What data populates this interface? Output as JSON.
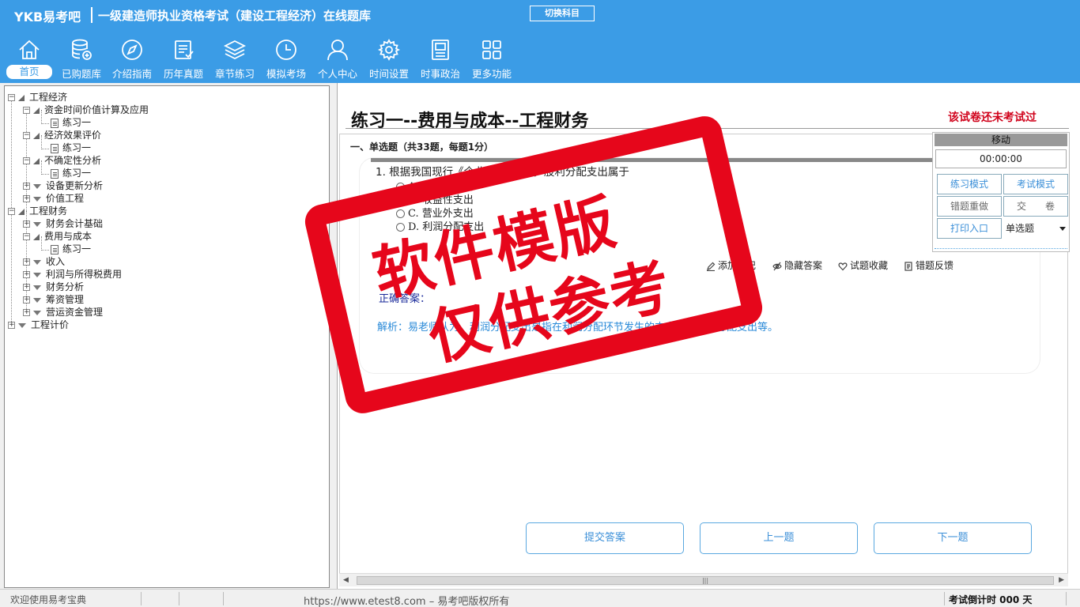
{
  "header": {
    "logo": "YKB易考吧",
    "title": "一级建造师执业资格考试（建设工程经济）在线题库",
    "switch_label": "切换科目"
  },
  "nav": [
    {
      "label": "首页",
      "icon": "home-icon"
    },
    {
      "label": "已购题库",
      "icon": "database-icon"
    },
    {
      "label": "介绍指南",
      "icon": "compass-icon"
    },
    {
      "label": "历年真题",
      "icon": "document-list-icon"
    },
    {
      "label": "章节练习",
      "icon": "layers-icon"
    },
    {
      "label": "模拟考场",
      "icon": "clock-icon"
    },
    {
      "label": "个人中心",
      "icon": "user-icon"
    },
    {
      "label": "时间设置",
      "icon": "gear-icon"
    },
    {
      "label": "时事政治",
      "icon": "news-icon"
    },
    {
      "label": "更多功能",
      "icon": "grid-icon"
    }
  ],
  "tree": {
    "expand_open": "−",
    "expand_closed": "+",
    "items": [
      "工程经济",
      "资金时间价值计算及应用",
      "练习一",
      "经济效果评价",
      "练习一",
      "不确定性分析",
      "练习一",
      "设备更新分析",
      "价值工程",
      "工程财务",
      "财务会计基础",
      "费用与成本",
      "练习一",
      "收入",
      "利润与所得税费用",
      "财务分析",
      "筹资管理",
      "营运资金管理",
      "工程计价"
    ]
  },
  "exam": {
    "title": "练习一--费用与成本--工程财务",
    "status": "该试卷还未考试过",
    "section": "一、单选题（共33题，每题1分）",
    "question": "1. 根据我国现行《企业会计准则》，股利分配支出属于",
    "options": [
      "A. 资本性支出",
      "B. 收益性支出",
      "C. 营业外支出",
      "D. 利润分配支出"
    ],
    "tools": [
      "添加笔记",
      "隐藏答案",
      "试题收藏",
      "错题反馈"
    ],
    "answer_label": "正确答案：",
    "analysis": "解析：易老师认为，利润分配支出是指在利润分配环节发生的支出，如股利分配支出等。"
  },
  "buttons": {
    "submit": "提交答案",
    "prev": "上一题",
    "next": "下一题"
  },
  "panel": {
    "move": "移动",
    "timer": "00:00:00",
    "practice_mode": "练习模式",
    "exam_mode": "考试模式",
    "redo_wrong": "错题重做",
    "hand_in": "交　　卷",
    "print": "打印入口",
    "question_type": "单选题"
  },
  "scroll": {
    "left": "◀",
    "right": "▶",
    "grip": "|||"
  },
  "stamp": {
    "line1": "软件模版",
    "line2": "仅供参考"
  },
  "status_bar": {
    "welcome": "欢迎使用易考宝典",
    "copyright": "https://www.etest8.com – 易考吧版权所有",
    "countdown": "考试倒计时 000 天"
  },
  "colors": {
    "brand_blue": "#3b9ce6",
    "status_red": "#d0021b",
    "stamp_red": "#e6061b",
    "analysis_blue": "#2a8ad8"
  }
}
